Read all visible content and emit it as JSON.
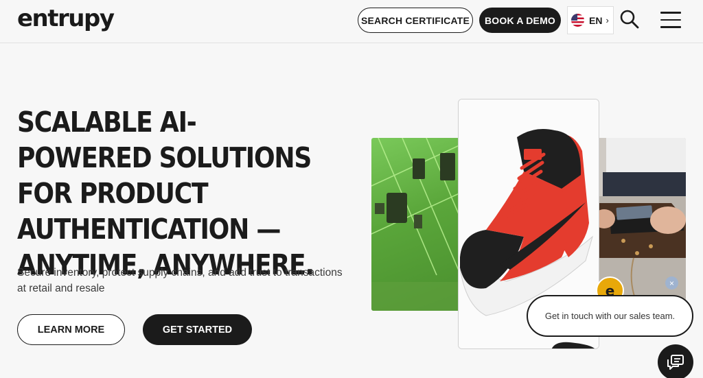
{
  "header": {
    "logo": "entrupy",
    "search_certificate_label": "SEARCH CERTIFICATE",
    "book_demo_label": "BOOK A DEMO",
    "language": {
      "code": "EN",
      "arrow": "›",
      "flag_icon": "us-flag-icon"
    },
    "search_icon": "search-icon",
    "menu_icon": "hamburger-menu-icon"
  },
  "hero": {
    "title": "SCALABLE AI-POWERED SOLUTIONS FOR PRODUCT AUTHENTICATION — ANYTIME, ANYWHERE.",
    "subtitle": "Secure inventory, protect supply chains, and add trust to transactions at retail and resale",
    "learn_more_label": "LEARN MORE",
    "get_started_label": "GET STARTED"
  },
  "chat": {
    "avatar_letter": "e",
    "close_symbol": "×",
    "message": "Get in touch with our sales team.",
    "chat_icon": "chat-bubbles-icon"
  },
  "colors": {
    "dark": "#1b1b1b",
    "background": "#f7f7f7",
    "accent_gold": "#e8a80a",
    "shoe_red": "#e43c2e"
  }
}
